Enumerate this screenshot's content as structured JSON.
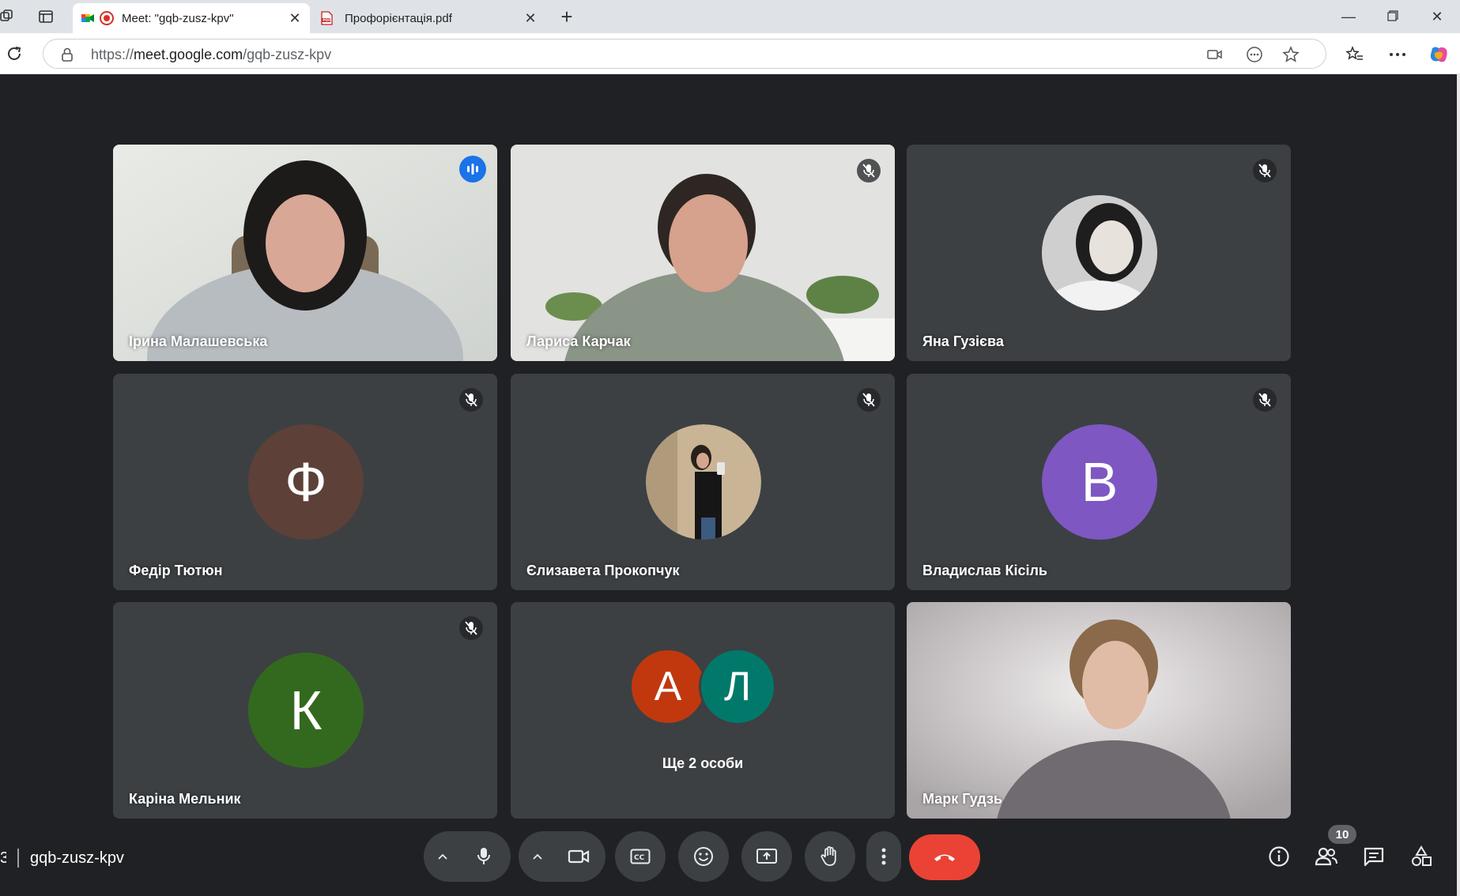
{
  "browser": {
    "tabs": [
      {
        "title": "Meet: \"gqb-zusz-kpv\"",
        "active": true
      },
      {
        "title": "Профорієнтація.pdf",
        "active": false
      }
    ],
    "url": {
      "scheme": "https://",
      "host": "meet.google.com",
      "path": "/gqb-zusz-kpv"
    }
  },
  "participants": [
    {
      "name": "Ірина Малашевська",
      "type": "video",
      "speaking": true,
      "muted": false
    },
    {
      "name": "Лариса Карчак",
      "type": "video",
      "speaking": false,
      "muted": true
    },
    {
      "name": "Яна Гузієва",
      "type": "photo",
      "speaking": false,
      "muted": true
    },
    {
      "name": "Федір Тютюн",
      "type": "letter",
      "letter": "Ф",
      "color": "#5d4037",
      "muted": true
    },
    {
      "name": "Єлизавета Прокопчук",
      "type": "photo",
      "speaking": false,
      "muted": true
    },
    {
      "name": "Владислав Кісіль",
      "type": "letter",
      "letter": "В",
      "color": "#7e57c2",
      "muted": true
    },
    {
      "name": "Каріна Мельник",
      "type": "letter",
      "letter": "К",
      "color": "#33691e",
      "muted": true
    },
    {
      "name": "Марк Гудзь",
      "type": "video",
      "speaking": false,
      "muted": false
    }
  ],
  "others": {
    "label": "Ще 2 особи",
    "avatars": [
      {
        "letter": "А",
        "color": "#c1380e"
      },
      {
        "letter": "Л",
        "color": "#00796b"
      }
    ]
  },
  "footer": {
    "time_fragment": "3",
    "meeting_code": "gqb-zusz-kpv",
    "people_count": "10"
  },
  "colors": {
    "stage_bg": "#202124",
    "tile_bg": "#3c4043",
    "end_call": "#ea4335",
    "speaking_outline": "#8ab4f8"
  }
}
